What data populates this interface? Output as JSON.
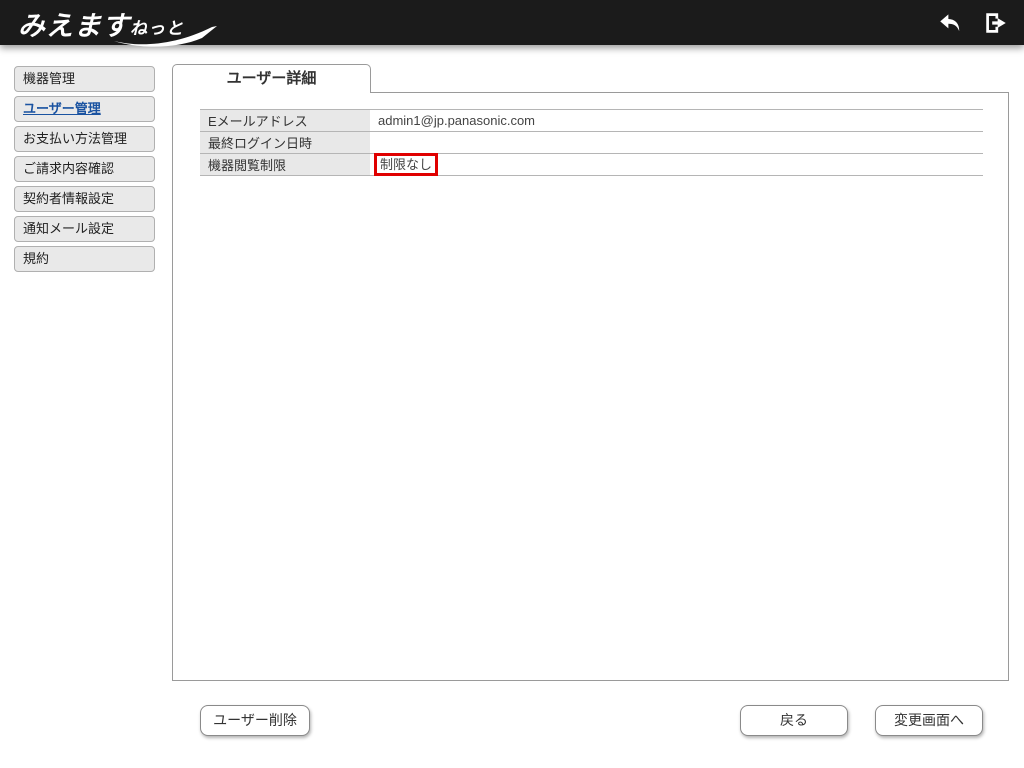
{
  "header": {
    "logo_main": "みえます",
    "logo_sub": "ねっと",
    "icons": {
      "back": "back-arrow-icon",
      "logout": "logout-icon"
    }
  },
  "sidebar": {
    "items": [
      {
        "label": "機器管理",
        "active": false
      },
      {
        "label": "ユーザー管理",
        "active": true
      },
      {
        "label": "お支払い方法管理",
        "active": false
      },
      {
        "label": "ご請求内容確認",
        "active": false
      },
      {
        "label": "契約者情報設定",
        "active": false
      },
      {
        "label": "通知メール設定",
        "active": false
      },
      {
        "label": "規約",
        "active": false
      }
    ]
  },
  "main": {
    "tab_label": "ユーザー詳細",
    "details": [
      {
        "label": "Eメールアドレス",
        "value": "admin1@jp.panasonic.com",
        "highlighted": false
      },
      {
        "label": "最終ログイン日時",
        "value": "",
        "highlighted": false
      },
      {
        "label": "機器閲覧制限",
        "value": "制限なし",
        "highlighted": true
      }
    ]
  },
  "footer": {
    "delete_button": "ユーザー削除",
    "back_button": "戻る",
    "change_button": "変更画面へ"
  },
  "colors": {
    "header_bg": "#1b1b1b",
    "active_link": "#1a53a1",
    "highlight_box": "#e00000",
    "sidebar_button_bg": "#e9e9e9",
    "label_cell_bg": "#e8e8e8"
  }
}
